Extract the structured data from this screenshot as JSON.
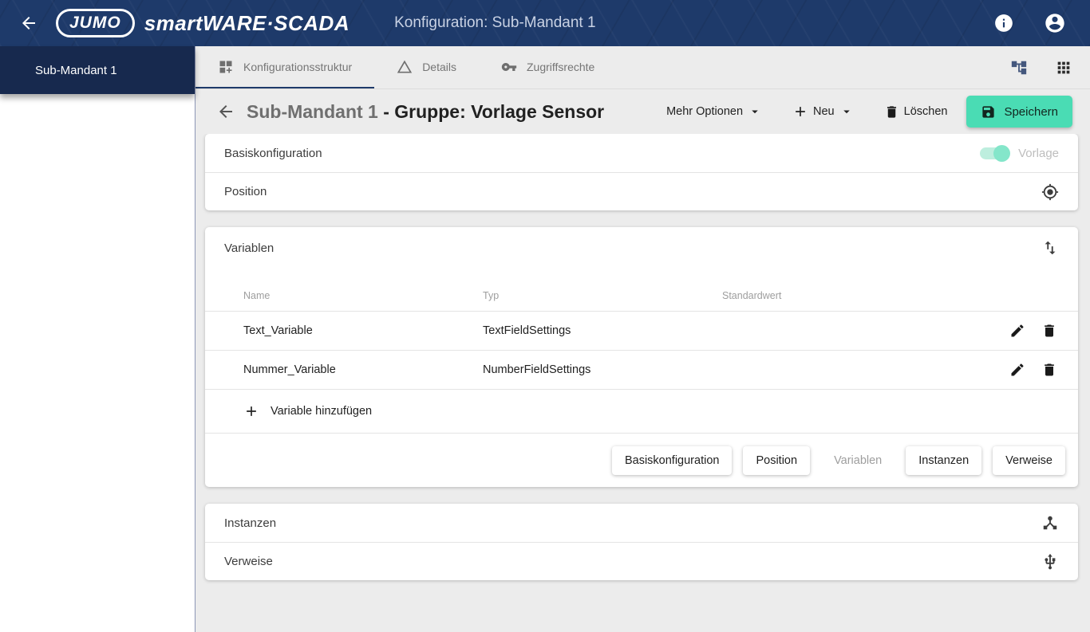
{
  "topbar": {
    "logo": "JUMO",
    "brand": "smartWARE·SCADA",
    "page_title": "Konfiguration: Sub-Mandant 1"
  },
  "sidebar": {
    "tenant": "Sub-Mandant 1"
  },
  "tabs": [
    {
      "label": "Konfigurationsstruktur",
      "active": true
    },
    {
      "label": "Details",
      "active": false
    },
    {
      "label": "Zugriffsrechte",
      "active": false
    }
  ],
  "toolbar": {
    "title_prefix": "Sub-Mandant 1 ",
    "title_main": "- Gruppe: Vorlage Sensor",
    "mehr_optionen_label": "Mehr Optionen",
    "neu_label": "Neu",
    "loeschen_label": "Löschen",
    "speichern_label": "Speichern"
  },
  "basiskonfiguration": {
    "label": "Basiskonfiguration",
    "toggle_label": "Vorlage",
    "toggle_on": true
  },
  "position": {
    "label": "Position"
  },
  "variablen": {
    "label": "Variablen",
    "columns": [
      "Name",
      "Typ",
      "Standardwert"
    ],
    "rows": [
      {
        "name": "Text_Variable",
        "typ": "TextFieldSettings",
        "standardwert": ""
      },
      {
        "name": "Nummer_Variable",
        "typ": "NumberFieldSettings",
        "standardwert": ""
      }
    ],
    "add_label": "Variable hinzufügen"
  },
  "footer_buttons": [
    {
      "label": "Basiskonfiguration",
      "disabled": false
    },
    {
      "label": "Position",
      "disabled": false
    },
    {
      "label": "Variablen",
      "disabled": true
    },
    {
      "label": "Instanzen",
      "disabled": false
    },
    {
      "label": "Verweise",
      "disabled": false
    }
  ],
  "instanzen": {
    "label": "Instanzen"
  },
  "verweise": {
    "label": "Verweise"
  },
  "colors": {
    "topbar_navy": "#1e3a6a",
    "sidebar_navy": "#17294e",
    "accent_mint": "#4adcb4",
    "active_tab_underline": "#1e3a6a"
  }
}
